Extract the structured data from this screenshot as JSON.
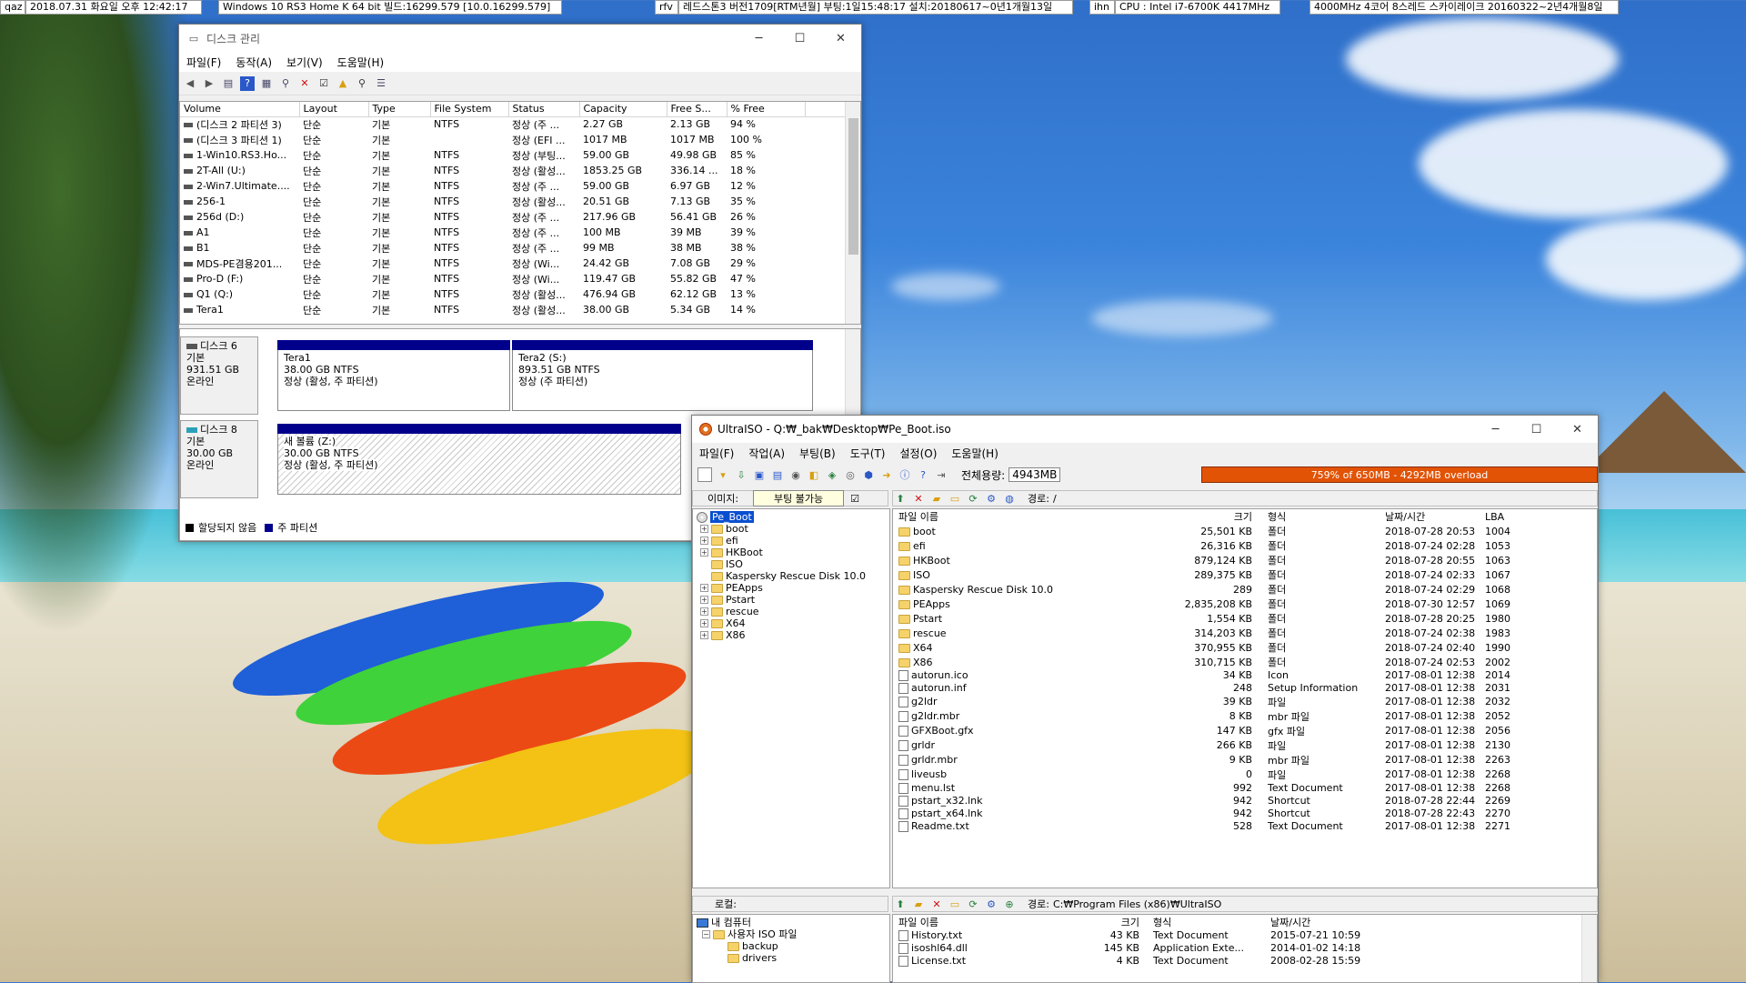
{
  "topbar": {
    "user": "qaz",
    "datetime": "2018.07.31 화요일 오후 12:42:17",
    "os": "Windows 10 RS3 Home K 64 bit 빌드:16299.579 [10.0.16299.579]",
    "build_tag": "rfv",
    "install_info": "레드스톤3 버전1709[RTM년월] 부팅:1일15:48:17 설치:20180617~0년1개월13일",
    "cpu_tag": "ihn",
    "cpu": "CPU : Intel i7-6700K 4417MHz",
    "cpu2": "4000MHz 4코어 8스레드 스카이레이크 20160322~2년4개월8일"
  },
  "diskmgmt": {
    "title": "디스크 관리",
    "menu": [
      "파일(F)",
      "동작(A)",
      "보기(V)",
      "도움말(H)"
    ],
    "columns": [
      "Volume",
      "Layout",
      "Type",
      "File System",
      "Status",
      "Capacity",
      "Free S...",
      "% Free"
    ],
    "rows": [
      [
        "(디스크 2 파티션 3)",
        "단순",
        "기본",
        "NTFS",
        "정상 (주 ...",
        "2.27 GB",
        "2.13 GB",
        "94 %"
      ],
      [
        "(디스크 3 파티션 1)",
        "단순",
        "기본",
        "",
        "정상 (EFI ...",
        "1017 MB",
        "1017 MB",
        "100 %"
      ],
      [
        "1-Win10.RS3.Ho...",
        "단순",
        "기본",
        "NTFS",
        "정상 (부팅...",
        "59.00 GB",
        "49.98 GB",
        "85 %"
      ],
      [
        "2T-All (U:)",
        "단순",
        "기본",
        "NTFS",
        "정상 (활성...",
        "1853.25 GB",
        "336.14 ...",
        "18 %"
      ],
      [
        "2-Win7.Ultimate....",
        "단순",
        "기본",
        "NTFS",
        "정상 (주 ...",
        "59.00 GB",
        "6.97 GB",
        "12 %"
      ],
      [
        "256-1",
        "단순",
        "기본",
        "NTFS",
        "정상 (활성...",
        "20.51 GB",
        "7.13 GB",
        "35 %"
      ],
      [
        "256d (D:)",
        "단순",
        "기본",
        "NTFS",
        "정상 (주 ...",
        "217.96 GB",
        "56.41 GB",
        "26 %"
      ],
      [
        "A1",
        "단순",
        "기본",
        "NTFS",
        "정상 (주 ...",
        "100 MB",
        "39 MB",
        "39 %"
      ],
      [
        "B1",
        "단순",
        "기본",
        "NTFS",
        "정상 (주 ...",
        "99 MB",
        "38 MB",
        "38 %"
      ],
      [
        "MDS-PE겸용201...",
        "단순",
        "기본",
        "NTFS",
        "정상 (Wi...",
        "24.42 GB",
        "7.08 GB",
        "29 %"
      ],
      [
        "Pro-D (F:)",
        "단순",
        "기본",
        "NTFS",
        "정상 (Wi...",
        "119.47 GB",
        "55.82 GB",
        "47 %"
      ],
      [
        "Q1 (Q:)",
        "단순",
        "기본",
        "NTFS",
        "정상 (활성...",
        "476.94 GB",
        "62.12 GB",
        "13 %"
      ],
      [
        "Tera1",
        "단순",
        "기본",
        "NTFS",
        "정상 (활성...",
        "38.00 GB",
        "5.34 GB",
        "14 %"
      ]
    ],
    "disk6": {
      "name": "디스크 6",
      "kind": "기본",
      "size": "931.51 GB",
      "state": "온라인",
      "p1": {
        "name": "Tera1",
        "size": "38.00 GB NTFS",
        "status": "정상 (활성, 주 파티션)"
      },
      "p2": {
        "name": "Tera2  (S:)",
        "size": "893.51 GB NTFS",
        "status": "정상 (주 파티션)"
      }
    },
    "disk8": {
      "name": "디스크 8",
      "kind": "기본",
      "size": "30.00 GB",
      "state": "온라인",
      "p1": {
        "name": "새 볼륨  (Z:)",
        "size": "30.00 GB NTFS",
        "status": "정상 (활성, 주 파티션)"
      }
    },
    "legend": {
      "unallocated": "할당되지 않음",
      "primary": "주 파티션"
    }
  },
  "ultraiso": {
    "title": "UltraISO - Q:₩_bak₩Desktop₩Pe_Boot.iso",
    "menu": [
      "파일(F)",
      "작업(A)",
      "부팅(B)",
      "도구(T)",
      "설정(O)",
      "도움말(H)"
    ],
    "total_label": "전체용량:",
    "total_value": "4943MB",
    "progress_text": "759% of 650MB - 4292MB overload",
    "progress_fraction": 1.0,
    "image_label": "이미지:",
    "image_type": "부팅 불가능",
    "path_label": "경로:",
    "path_value": "/",
    "tree_root": "Pe_Boot",
    "tree": [
      "boot",
      "efi",
      "HKBoot",
      "ISO",
      "Kaspersky Rescue Disk 10.0",
      "PEApps",
      "Pstart",
      "rescue",
      "X64",
      "X86"
    ],
    "tree_expandable": [
      true,
      true,
      true,
      false,
      false,
      true,
      true,
      true,
      true,
      true
    ],
    "columns": [
      "파일 이름",
      "크기",
      "형식",
      "날짜/시간",
      "LBA"
    ],
    "files": [
      {
        "name": "boot",
        "size": "25,501 KB",
        "type": "폴더",
        "date": "2018-07-28 20:53",
        "lba": "1004",
        "folder": true
      },
      {
        "name": "efi",
        "size": "26,316 KB",
        "type": "폴더",
        "date": "2018-07-24 02:28",
        "lba": "1053",
        "folder": true
      },
      {
        "name": "HKBoot",
        "size": "879,124 KB",
        "type": "폴더",
        "date": "2018-07-28 20:55",
        "lba": "1063",
        "folder": true
      },
      {
        "name": "ISO",
        "size": "289,375 KB",
        "type": "폴더",
        "date": "2018-07-24 02:33",
        "lba": "1067",
        "folder": true
      },
      {
        "name": "Kaspersky Rescue Disk 10.0",
        "size": "289",
        "type": "폴더",
        "date": "2018-07-24 02:29",
        "lba": "1068",
        "folder": true
      },
      {
        "name": "PEApps",
        "size": "2,835,208 KB",
        "type": "폴더",
        "date": "2018-07-30 12:57",
        "lba": "1069",
        "folder": true
      },
      {
        "name": "Pstart",
        "size": "1,554 KB",
        "type": "폴더",
        "date": "2018-07-28 20:25",
        "lba": "1980",
        "folder": true
      },
      {
        "name": "rescue",
        "size": "314,203 KB",
        "type": "폴더",
        "date": "2018-07-24 02:38",
        "lba": "1983",
        "folder": true
      },
      {
        "name": "X64",
        "size": "370,955 KB",
        "type": "폴더",
        "date": "2018-07-24 02:40",
        "lba": "1990",
        "folder": true
      },
      {
        "name": "X86",
        "size": "310,715 KB",
        "type": "폴더",
        "date": "2018-07-24 02:53",
        "lba": "2002",
        "folder": true
      },
      {
        "name": "autorun.ico",
        "size": "34 KB",
        "type": "Icon",
        "date": "2017-08-01 12:38",
        "lba": "2014",
        "folder": false
      },
      {
        "name": "autorun.inf",
        "size": "248",
        "type": "Setup Information",
        "date": "2017-08-01 12:38",
        "lba": "2031",
        "folder": false
      },
      {
        "name": "g2ldr",
        "size": "39 KB",
        "type": "파일",
        "date": "2017-08-01 12:38",
        "lba": "2032",
        "folder": false
      },
      {
        "name": "g2ldr.mbr",
        "size": "8 KB",
        "type": "mbr 파일",
        "date": "2017-08-01 12:38",
        "lba": "2052",
        "folder": false
      },
      {
        "name": "GFXBoot.gfx",
        "size": "147 KB",
        "type": "gfx 파일",
        "date": "2017-08-01 12:38",
        "lba": "2056",
        "folder": false
      },
      {
        "name": "grldr",
        "size": "266 KB",
        "type": "파일",
        "date": "2017-08-01 12:38",
        "lba": "2130",
        "folder": false
      },
      {
        "name": "grldr.mbr",
        "size": "9 KB",
        "type": "mbr 파일",
        "date": "2017-08-01 12:38",
        "lba": "2263",
        "folder": false
      },
      {
        "name": "liveusb",
        "size": "0",
        "type": "파일",
        "date": "2017-08-01 12:38",
        "lba": "2268",
        "folder": false
      },
      {
        "name": "menu.lst",
        "size": "992",
        "type": "Text Document",
        "date": "2017-08-01 12:38",
        "lba": "2268",
        "folder": false
      },
      {
        "name": "pstart_x32.lnk",
        "size": "942",
        "type": "Shortcut",
        "date": "2018-07-28 22:44",
        "lba": "2269",
        "folder": false
      },
      {
        "name": "pstart_x64.lnk",
        "size": "942",
        "type": "Shortcut",
        "date": "2018-07-28 22:43",
        "lba": "2270",
        "folder": false
      },
      {
        "name": "Readme.txt",
        "size": "528",
        "type": "Text Document",
        "date": "2017-08-01 12:38",
        "lba": "2271",
        "folder": false
      }
    ],
    "local_label": "로컬:",
    "local_path_label": "경로:",
    "local_path": "C:₩Program Files (x86)₩UltraISO",
    "local_tree": [
      "내 컴퓨터",
      "사용자 ISO 파일",
      "backup",
      "drivers"
    ],
    "local_columns": [
      "파일 이름",
      "크기",
      "형식",
      "날짜/시간"
    ],
    "local_files": [
      {
        "name": "History.txt",
        "size": "43 KB",
        "type": "Text Document",
        "date": "2015-07-21 10:59"
      },
      {
        "name": "isoshl64.dll",
        "size": "145 KB",
        "type": "Application Exte...",
        "date": "2014-01-02 14:18"
      },
      {
        "name": "License.txt",
        "size": "4 KB",
        "type": "Text Document",
        "date": "2008-02-28 15:59"
      }
    ]
  }
}
